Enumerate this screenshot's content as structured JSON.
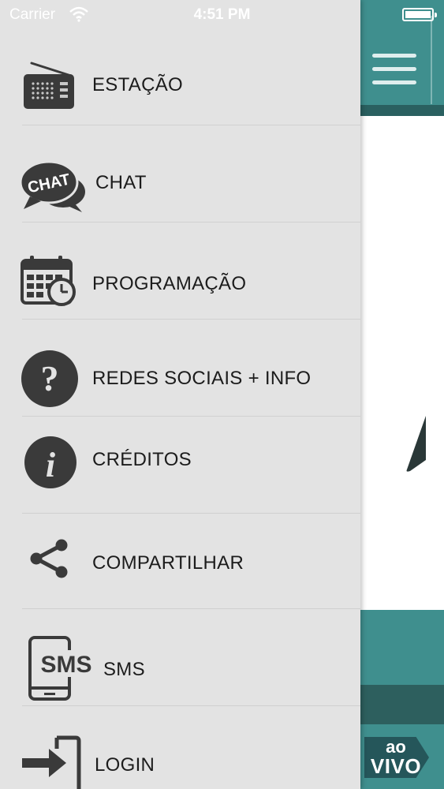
{
  "status_bar": {
    "carrier": "Carrier",
    "time": "4:51 PM"
  },
  "menu": {
    "items": [
      {
        "label": "ESTAÇÃO",
        "icon": "radio-icon"
      },
      {
        "label": "CHAT",
        "icon": "chat-bubble-icon"
      },
      {
        "label": "PROGRAMAÇÃO",
        "icon": "calendar-clock-icon"
      },
      {
        "label": "REDES SOCIAIS + INFO",
        "icon": "question-icon"
      },
      {
        "label": "CRÉDITOS",
        "icon": "info-icon"
      },
      {
        "label": "COMPARTILHAR",
        "icon": "share-icon"
      },
      {
        "label": "SMS",
        "icon": "sms-phone-icon"
      },
      {
        "label": "LOGIN",
        "icon": "login-icon"
      }
    ],
    "chat_icon_text": "CHAT",
    "sms_icon_text": "SMS"
  },
  "app": {
    "live_badge_line1": "ao",
    "live_badge_line2": "VIVO"
  },
  "colors": {
    "drawer_bg": "#e3e3e3",
    "icon_dark": "#3a3a3a",
    "app_teal": "#3f8f8e",
    "app_teal_dark": "#2d5f5e"
  }
}
